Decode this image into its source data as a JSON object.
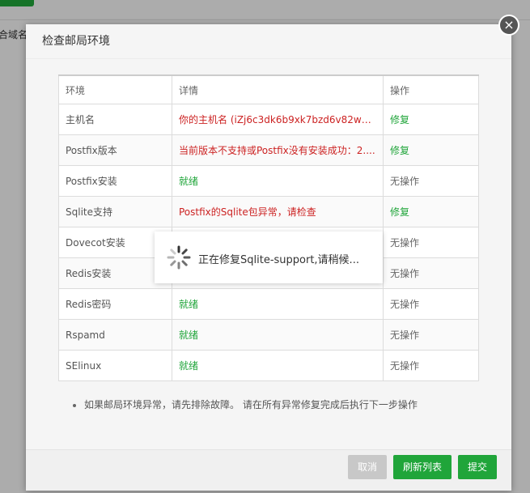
{
  "background": {
    "fragment_text": "合域名"
  },
  "dialog": {
    "title": "检查邮局环境",
    "close_glyph": "×",
    "columns": [
      "环境",
      "详情",
      "操作"
    ],
    "rows": [
      {
        "env": "主机名",
        "detail": "你的主机名 (iZj6c3dk6b9xk7bzd6v82wZ) ...",
        "status": "error",
        "action": "修复"
      },
      {
        "env": "Postfix版本",
        "detail": "当前版本不支持或Postfix没有安装成功：2....",
        "status": "error",
        "action": "修复"
      },
      {
        "env": "Postfix安装",
        "detail": "就绪",
        "status": "ok",
        "action": "无操作"
      },
      {
        "env": "Sqlite支持",
        "detail": "Postfix的Sqlite包异常，请检查",
        "status": "error",
        "action": "修复"
      },
      {
        "env": "Dovecot安装",
        "detail": "",
        "status": "ok",
        "action": "无操作"
      },
      {
        "env": "Redis安装",
        "detail": "",
        "status": "ok",
        "action": "无操作"
      },
      {
        "env": "Redis密码",
        "detail": "就绪",
        "status": "ok",
        "action": "无操作"
      },
      {
        "env": "Rspamd",
        "detail": "就绪",
        "status": "ok",
        "action": "无操作"
      },
      {
        "env": "SElinux",
        "detail": "就绪",
        "status": "ok",
        "action": "无操作"
      }
    ],
    "note": "如果邮局环境异常，请先排除故障。 请在所有异常修复完成后执行下一步操作",
    "buttons": {
      "cancel": "取消",
      "refresh": "刷新列表",
      "submit": "提交"
    }
  },
  "loading": {
    "message": "正在修复Sqlite-support,请稍候..."
  },
  "colors": {
    "accent": "#20a53a",
    "error": "#cc2222"
  }
}
